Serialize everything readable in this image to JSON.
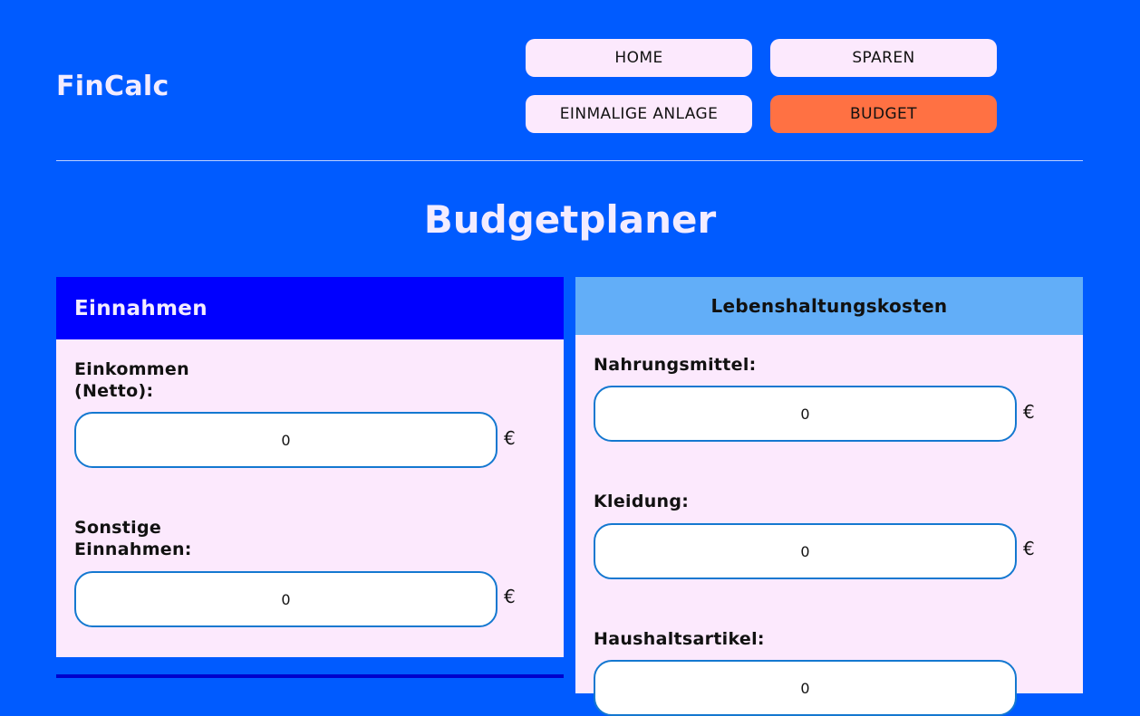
{
  "app": {
    "logo": "FinCalc"
  },
  "nav": {
    "items": [
      {
        "label": "HOME",
        "active": false
      },
      {
        "label": "SPAREN",
        "active": false
      },
      {
        "label": "EINMALIGE ANLAGE",
        "active": false
      },
      {
        "label": "BUDGET",
        "active": true
      }
    ]
  },
  "page": {
    "title": "Budgetplaner"
  },
  "income": {
    "title": "Einnahmen",
    "fields": [
      {
        "label": "Einkommen (Netto):",
        "value": "0",
        "unit": "€"
      },
      {
        "label": "Sonstige Einnahmen:",
        "value": "0",
        "unit": "€"
      }
    ]
  },
  "living_costs": {
    "title": "Lebenshaltungskosten",
    "fields": [
      {
        "label": "Nahrungsmittel:",
        "value": "0",
        "unit": "€"
      },
      {
        "label": "Kleidung:",
        "value": "0",
        "unit": "€"
      },
      {
        "label": "Haushaltsartikel:",
        "value": "0",
        "unit": "€"
      }
    ]
  },
  "colors": {
    "background": "#005bff",
    "nav_button": "#fce9fd",
    "nav_active": "#ff7143",
    "income_header": "#0000ff",
    "costs_header": "#62aef8",
    "panel_body": "#fce9fd",
    "input_border": "#1478d0"
  }
}
